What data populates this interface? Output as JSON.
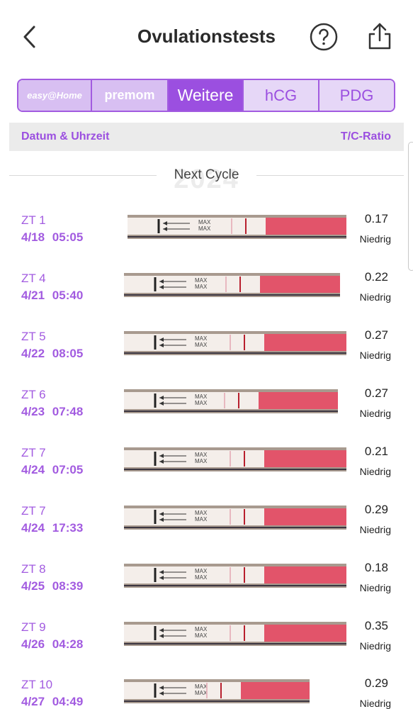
{
  "header": {
    "title": "Ovulationstests",
    "back_icon": "chevron-left-icon",
    "help_icon": "question-circle-icon",
    "share_icon": "share-icon"
  },
  "tabs": [
    {
      "label": "easy@Home",
      "type": "logo"
    },
    {
      "label": "premom",
      "type": "logo"
    },
    {
      "label": "Weitere",
      "type": "text",
      "active": true
    },
    {
      "label": "hCG",
      "type": "text"
    },
    {
      "label": "PDG",
      "type": "text"
    }
  ],
  "columns": {
    "left": "Datum & Uhrzeit",
    "right": "T/C-Ratio"
  },
  "cycle": {
    "label": "Next Cycle",
    "year": "2024"
  },
  "colors": {
    "accent": "#9b4fe0",
    "tab_inactive": "#e6d7f7",
    "tab_logo_bg": "#d8bff2",
    "strip_pink": "#e2546a"
  },
  "strip_text": "MAX",
  "entries": [
    {
      "day": "ZT 1",
      "date": "4/18 05:05",
      "ratio": "0.17",
      "level": "Niedrig"
    },
    {
      "day": "ZT 4",
      "date": "4/21 05:40",
      "ratio": "0.22",
      "level": "Niedrig"
    },
    {
      "day": "ZT 5",
      "date": "4/22 08:05",
      "ratio": "0.27",
      "level": "Niedrig"
    },
    {
      "day": "ZT 6",
      "date": "4/23 07:48",
      "ratio": "0.27",
      "level": "Niedrig"
    },
    {
      "day": "ZT 7",
      "date": "4/24 07:05",
      "ratio": "0.21",
      "level": "Niedrig"
    },
    {
      "day": "ZT 7",
      "date": "4/24 17:33",
      "ratio": "0.29",
      "level": "Niedrig"
    },
    {
      "day": "ZT 8",
      "date": "4/25 08:39",
      "ratio": "0.18",
      "level": "Niedrig"
    },
    {
      "day": "ZT 9",
      "date": "4/26 04:28",
      "ratio": "0.35",
      "level": "Niedrig"
    },
    {
      "day": "ZT 10",
      "date": "4/27 04:49",
      "ratio": "0.29",
      "level": "Niedrig"
    }
  ]
}
